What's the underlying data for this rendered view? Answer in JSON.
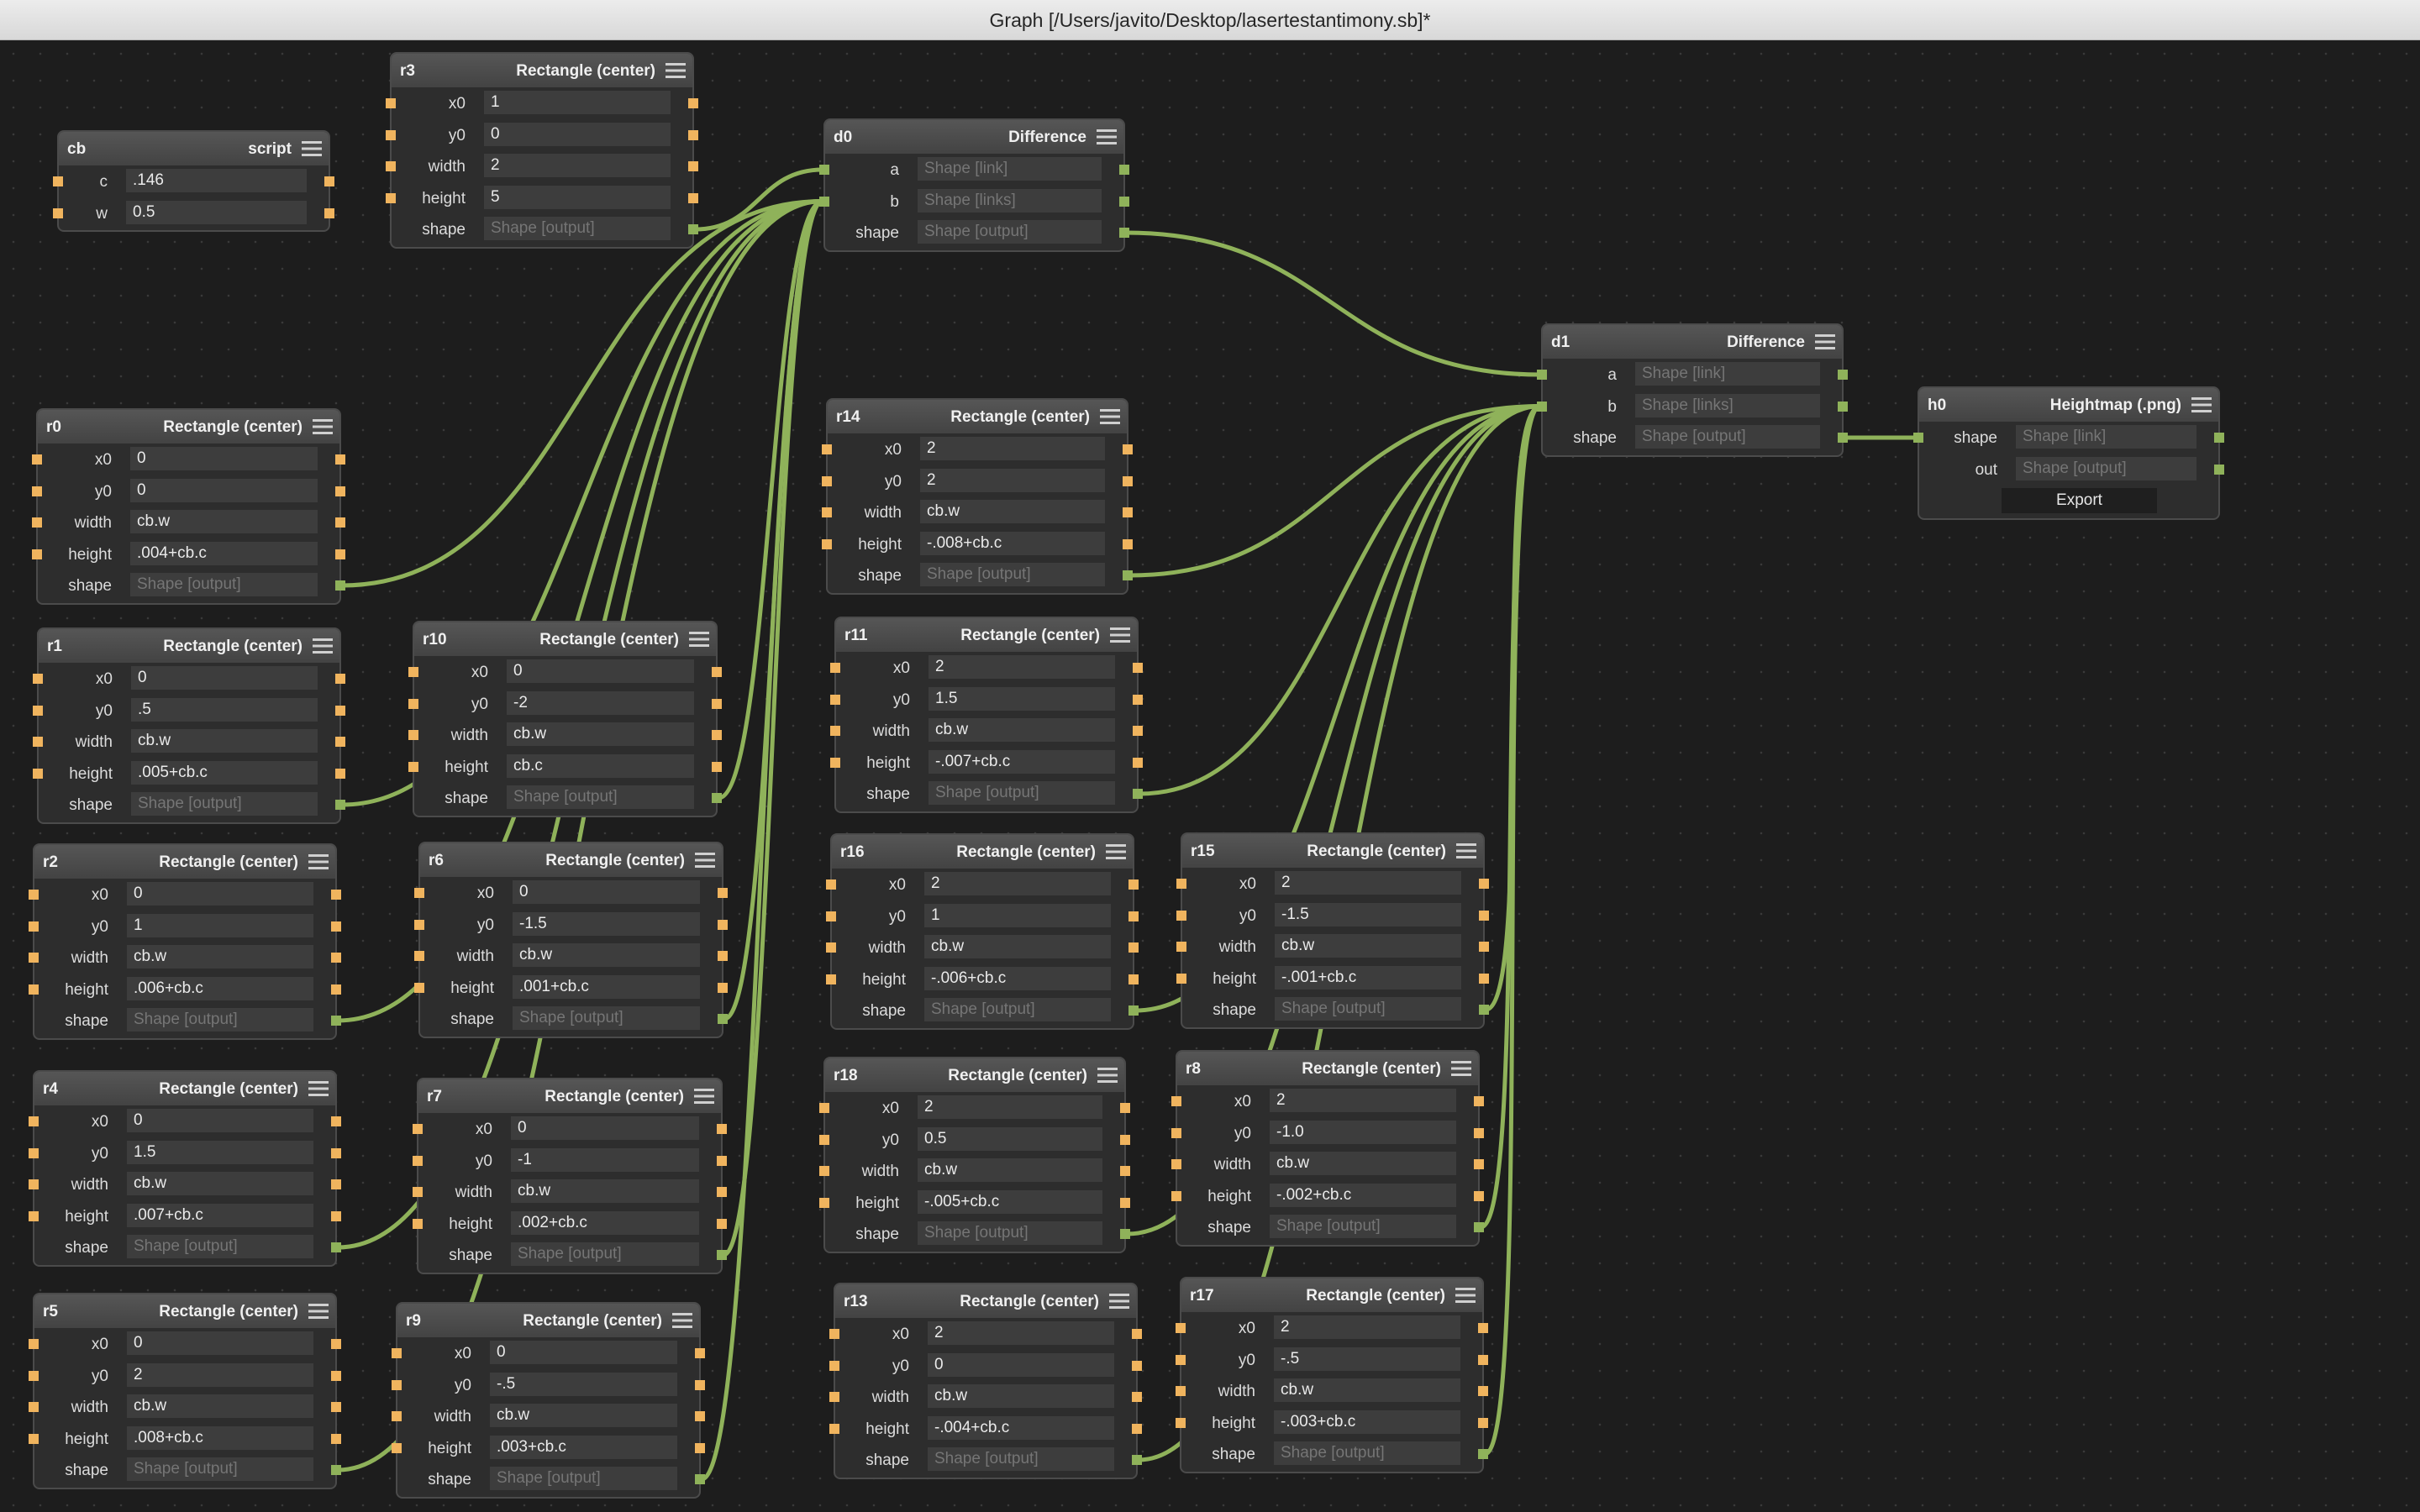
{
  "window": {
    "title": "Graph [/Users/javito/Desktop/lasertestantimony.sb]*"
  },
  "colors": {
    "canvas": "#1d1d1d",
    "wire": "#8fb25a",
    "number_port": "#f0b45e",
    "shape_port": "#8fb25a"
  },
  "icons": {
    "node_menu": "hamburger-menu-icon"
  },
  "nodes": [
    {
      "id": "cb",
      "type": "script",
      "rows": [
        {
          "label": "c",
          "value": ".146",
          "port": "number"
        },
        {
          "label": "w",
          "value": "0.5",
          "port": "number"
        }
      ]
    },
    {
      "id": "r3",
      "type": "Rectangle (center)",
      "rows": [
        {
          "label": "x0",
          "value": "1",
          "port": "number"
        },
        {
          "label": "y0",
          "value": "0",
          "port": "number"
        },
        {
          "label": "width",
          "value": "2",
          "port": "number"
        },
        {
          "label": "height",
          "value": "5",
          "port": "number"
        },
        {
          "label": "shape",
          "placeholder": "Shape [output]",
          "port": "shape",
          "output_only": true
        }
      ]
    },
    {
      "id": "d0",
      "type": "Difference",
      "rows": [
        {
          "label": "a",
          "placeholder": "Shape [link]",
          "port": "shape"
        },
        {
          "label": "b",
          "placeholder": "Shape [links]",
          "port": "shape"
        },
        {
          "label": "shape",
          "placeholder": "Shape [output]",
          "port": "shape",
          "output_only": true
        }
      ]
    },
    {
      "id": "d1",
      "type": "Difference",
      "rows": [
        {
          "label": "a",
          "placeholder": "Shape [link]",
          "port": "shape"
        },
        {
          "label": "b",
          "placeholder": "Shape [links]",
          "port": "shape"
        },
        {
          "label": "shape",
          "placeholder": "Shape [output]",
          "port": "shape",
          "output_only": true
        }
      ]
    },
    {
      "id": "h0",
      "type": "Heightmap (.png)",
      "rows": [
        {
          "label": "shape",
          "placeholder": "Shape [link]",
          "port": "shape"
        },
        {
          "label": "out",
          "placeholder": "Shape [output]",
          "port": "shape",
          "output_only": true
        },
        {
          "button": "Export"
        }
      ]
    },
    {
      "id": "r0",
      "type": "Rectangle (center)",
      "rows": [
        {
          "label": "x0",
          "value": "0",
          "port": "number"
        },
        {
          "label": "y0",
          "value": "0",
          "port": "number"
        },
        {
          "label": "width",
          "value": "cb.w",
          "port": "number"
        },
        {
          "label": "height",
          "value": ".004+cb.c",
          "port": "number"
        },
        {
          "label": "shape",
          "placeholder": "Shape [output]",
          "port": "shape",
          "output_only": true
        }
      ]
    },
    {
      "id": "r1",
      "type": "Rectangle (center)",
      "rows": [
        {
          "label": "x0",
          "value": "0",
          "port": "number"
        },
        {
          "label": "y0",
          "value": ".5",
          "port": "number"
        },
        {
          "label": "width",
          "value": "cb.w",
          "port": "number"
        },
        {
          "label": "height",
          "value": ".005+cb.c",
          "port": "number"
        },
        {
          "label": "shape",
          "placeholder": "Shape [output]",
          "port": "shape",
          "output_only": true
        }
      ]
    },
    {
      "id": "r2",
      "type": "Rectangle (center)",
      "rows": [
        {
          "label": "x0",
          "value": "0",
          "port": "number"
        },
        {
          "label": "y0",
          "value": "1",
          "port": "number"
        },
        {
          "label": "width",
          "value": "cb.w",
          "port": "number"
        },
        {
          "label": "height",
          "value": ".006+cb.c",
          "port": "number"
        },
        {
          "label": "shape",
          "placeholder": "Shape [output]",
          "port": "shape",
          "output_only": true
        }
      ]
    },
    {
      "id": "r4",
      "type": "Rectangle (center)",
      "rows": [
        {
          "label": "x0",
          "value": "0",
          "port": "number"
        },
        {
          "label": "y0",
          "value": "1.5",
          "port": "number"
        },
        {
          "label": "width",
          "value": "cb.w",
          "port": "number"
        },
        {
          "label": "height",
          "value": ".007+cb.c",
          "port": "number"
        },
        {
          "label": "shape",
          "placeholder": "Shape [output]",
          "port": "shape",
          "output_only": true
        }
      ]
    },
    {
      "id": "r5",
      "type": "Rectangle (center)",
      "rows": [
        {
          "label": "x0",
          "value": "0",
          "port": "number"
        },
        {
          "label": "y0",
          "value": "2",
          "port": "number"
        },
        {
          "label": "width",
          "value": "cb.w",
          "port": "number"
        },
        {
          "label": "height",
          "value": ".008+cb.c",
          "port": "number"
        },
        {
          "label": "shape",
          "placeholder": "Shape [output]",
          "port": "shape",
          "output_only": true
        }
      ]
    },
    {
      "id": "r10",
      "type": "Rectangle (center)",
      "rows": [
        {
          "label": "x0",
          "value": "0",
          "port": "number"
        },
        {
          "label": "y0",
          "value": "-2",
          "port": "number"
        },
        {
          "label": "width",
          "value": "cb.w",
          "port": "number"
        },
        {
          "label": "height",
          "value": "cb.c",
          "port": "number"
        },
        {
          "label": "shape",
          "placeholder": "Shape [output]",
          "port": "shape",
          "output_only": true
        }
      ]
    },
    {
      "id": "r6",
      "type": "Rectangle (center)",
      "rows": [
        {
          "label": "x0",
          "value": "0",
          "port": "number"
        },
        {
          "label": "y0",
          "value": "-1.5",
          "port": "number"
        },
        {
          "label": "width",
          "value": "cb.w",
          "port": "number"
        },
        {
          "label": "height",
          "value": ".001+cb.c",
          "port": "number"
        },
        {
          "label": "shape",
          "placeholder": "Shape [output]",
          "port": "shape",
          "output_only": true
        }
      ]
    },
    {
      "id": "r7",
      "type": "Rectangle (center)",
      "rows": [
        {
          "label": "x0",
          "value": "0",
          "port": "number"
        },
        {
          "label": "y0",
          "value": "-1",
          "port": "number"
        },
        {
          "label": "width",
          "value": "cb.w",
          "port": "number"
        },
        {
          "label": "height",
          "value": ".002+cb.c",
          "port": "number"
        },
        {
          "label": "shape",
          "placeholder": "Shape [output]",
          "port": "shape",
          "output_only": true
        }
      ]
    },
    {
      "id": "r9",
      "type": "Rectangle (center)",
      "rows": [
        {
          "label": "x0",
          "value": "0",
          "port": "number"
        },
        {
          "label": "y0",
          "value": "-.5",
          "port": "number"
        },
        {
          "label": "width",
          "value": "cb.w",
          "port": "number"
        },
        {
          "label": "height",
          "value": ".003+cb.c",
          "port": "number"
        },
        {
          "label": "shape",
          "placeholder": "Shape [output]",
          "port": "shape",
          "output_only": true
        }
      ]
    },
    {
      "id": "r14",
      "type": "Rectangle (center)",
      "rows": [
        {
          "label": "x0",
          "value": "2",
          "port": "number"
        },
        {
          "label": "y0",
          "value": "2",
          "port": "number"
        },
        {
          "label": "width",
          "value": "cb.w",
          "port": "number"
        },
        {
          "label": "height",
          "value": "-.008+cb.c",
          "port": "number"
        },
        {
          "label": "shape",
          "placeholder": "Shape [output]",
          "port": "shape",
          "output_only": true
        }
      ]
    },
    {
      "id": "r11",
      "type": "Rectangle (center)",
      "rows": [
        {
          "label": "x0",
          "value": "2",
          "port": "number"
        },
        {
          "label": "y0",
          "value": "1.5",
          "port": "number"
        },
        {
          "label": "width",
          "value": "cb.w",
          "port": "number"
        },
        {
          "label": "height",
          "value": "-.007+cb.c",
          "port": "number"
        },
        {
          "label": "shape",
          "placeholder": "Shape [output]",
          "port": "shape",
          "output_only": true
        }
      ]
    },
    {
      "id": "r16",
      "type": "Rectangle (center)",
      "rows": [
        {
          "label": "x0",
          "value": "2",
          "port": "number"
        },
        {
          "label": "y0",
          "value": "1",
          "port": "number"
        },
        {
          "label": "width",
          "value": "cb.w",
          "port": "number"
        },
        {
          "label": "height",
          "value": "-.006+cb.c",
          "port": "number"
        },
        {
          "label": "shape",
          "placeholder": "Shape [output]",
          "port": "shape",
          "output_only": true
        }
      ]
    },
    {
      "id": "r18",
      "type": "Rectangle (center)",
      "rows": [
        {
          "label": "x0",
          "value": "2",
          "port": "number"
        },
        {
          "label": "y0",
          "value": "0.5",
          "port": "number"
        },
        {
          "label": "width",
          "value": "cb.w",
          "port": "number"
        },
        {
          "label": "height",
          "value": "-.005+cb.c",
          "port": "number"
        },
        {
          "label": "shape",
          "placeholder": "Shape [output]",
          "port": "shape",
          "output_only": true
        }
      ]
    },
    {
      "id": "r13",
      "type": "Rectangle (center)",
      "rows": [
        {
          "label": "x0",
          "value": "2",
          "port": "number"
        },
        {
          "label": "y0",
          "value": "0",
          "port": "number"
        },
        {
          "label": "width",
          "value": "cb.w",
          "port": "number"
        },
        {
          "label": "height",
          "value": "-.004+cb.c",
          "port": "number"
        },
        {
          "label": "shape",
          "placeholder": "Shape [output]",
          "port": "shape",
          "output_only": true
        }
      ]
    },
    {
      "id": "r15",
      "type": "Rectangle (center)",
      "rows": [
        {
          "label": "x0",
          "value": "2",
          "port": "number"
        },
        {
          "label": "y0",
          "value": "-1.5",
          "port": "number"
        },
        {
          "label": "width",
          "value": "cb.w",
          "port": "number"
        },
        {
          "label": "height",
          "value": "-.001+cb.c",
          "port": "number"
        },
        {
          "label": "shape",
          "placeholder": "Shape [output]",
          "port": "shape",
          "output_only": true
        }
      ]
    },
    {
      "id": "r8",
      "type": "Rectangle (center)",
      "rows": [
        {
          "label": "x0",
          "value": "2",
          "port": "number"
        },
        {
          "label": "y0",
          "value": "-1.0",
          "port": "number"
        },
        {
          "label": "width",
          "value": "cb.w",
          "port": "number"
        },
        {
          "label": "height",
          "value": "-.002+cb.c",
          "port": "number"
        },
        {
          "label": "shape",
          "placeholder": "Shape [output]",
          "port": "shape",
          "output_only": true
        }
      ]
    },
    {
      "id": "r17",
      "type": "Rectangle (center)",
      "rows": [
        {
          "label": "x0",
          "value": "2",
          "port": "number"
        },
        {
          "label": "y0",
          "value": "-.5",
          "port": "number"
        },
        {
          "label": "width",
          "value": "cb.w",
          "port": "number"
        },
        {
          "label": "height",
          "value": "-.003+cb.c",
          "port": "number"
        },
        {
          "label": "shape",
          "placeholder": "Shape [output]",
          "port": "shape",
          "output_only": true
        }
      ]
    }
  ],
  "connections": [
    {
      "from": "r3",
      "to": "d0",
      "input": "a"
    },
    {
      "from": "r0",
      "to": "d0",
      "input": "b"
    },
    {
      "from": "r1",
      "to": "d0",
      "input": "b"
    },
    {
      "from": "r2",
      "to": "d0",
      "input": "b"
    },
    {
      "from": "r4",
      "to": "d0",
      "input": "b"
    },
    {
      "from": "r5",
      "to": "d0",
      "input": "b"
    },
    {
      "from": "r10",
      "to": "d0",
      "input": "b"
    },
    {
      "from": "r6",
      "to": "d0",
      "input": "b"
    },
    {
      "from": "r7",
      "to": "d0",
      "input": "b"
    },
    {
      "from": "r9",
      "to": "d0",
      "input": "b"
    },
    {
      "from": "d0",
      "to": "d1",
      "input": "a"
    },
    {
      "from": "r14",
      "to": "d1",
      "input": "b"
    },
    {
      "from": "r11",
      "to": "d1",
      "input": "b"
    },
    {
      "from": "r16",
      "to": "d1",
      "input": "b"
    },
    {
      "from": "r18",
      "to": "d1",
      "input": "b"
    },
    {
      "from": "r13",
      "to": "d1",
      "input": "b"
    },
    {
      "from": "r15",
      "to": "d1",
      "input": "b"
    },
    {
      "from": "r8",
      "to": "d1",
      "input": "b"
    },
    {
      "from": "r17",
      "to": "d1",
      "input": "b"
    },
    {
      "from": "d1",
      "to": "h0",
      "input": "shape"
    }
  ]
}
